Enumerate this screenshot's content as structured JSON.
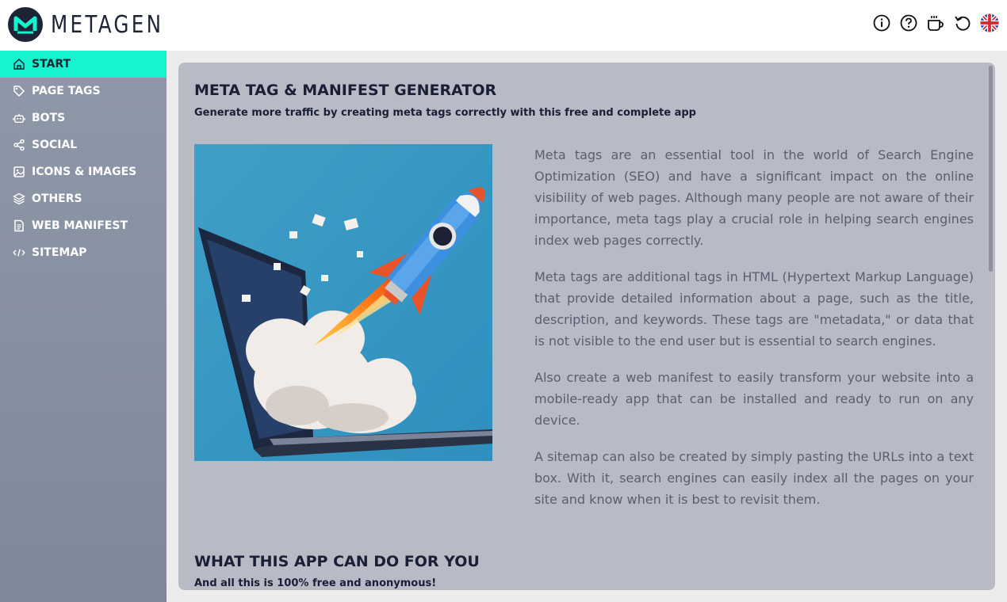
{
  "app": {
    "logo_text": "METAGEN",
    "accent_color": "#14f5cf",
    "header_icons": [
      "info-icon",
      "help-icon",
      "coffee-icon",
      "reset-icon",
      "uk-flag-icon"
    ]
  },
  "sidebar": {
    "items": [
      {
        "label": "START",
        "icon": "home-icon",
        "active": true
      },
      {
        "label": "PAGE TAGS",
        "icon": "tag-icon"
      },
      {
        "label": "BOTS",
        "icon": "robot-icon"
      },
      {
        "label": "SOCIAL",
        "icon": "share-icon"
      },
      {
        "label": "ICONS & IMAGES",
        "icon": "image-icon"
      },
      {
        "label": "OTHERS",
        "icon": "layers-icon"
      },
      {
        "label": "WEB MANIFEST",
        "icon": "document-icon"
      },
      {
        "label": "SITEMAP",
        "icon": "code-icon"
      }
    ]
  },
  "main": {
    "title": "META TAG & MANIFEST GENERATOR",
    "subtitle": "Generate more traffic by creating meta tags correctly with this free and complete app",
    "paragraphs": [
      "Meta tags are an essential tool in the world of Search Engine Optimization (SEO) and have a significant impact on the online visibility of web pages. Although many people are not aware of their importance, meta tags play a crucial role in helping search engines index web pages correctly.",
      "Meta tags are additional tags in HTML (Hypertext Markup Language) that provide detailed information about a page, such as the title, description, and keywords. These tags are \"metadata,\" or data that is not visible to the end user but is essential to search engines.",
      "Also create a web manifest to easily transform your website into a mobile-ready app that can be installed and ready to run on any device.",
      "A sitemap can also be created by simply pasting the URLs into a text box. With it, search engines can easily index all the pages on your site and know when it is best to revisit them."
    ],
    "section2_title": "WHAT THIS APP CAN DO FOR YOU",
    "section2_subtitle": "And all this is 100% free and anonymous!"
  }
}
